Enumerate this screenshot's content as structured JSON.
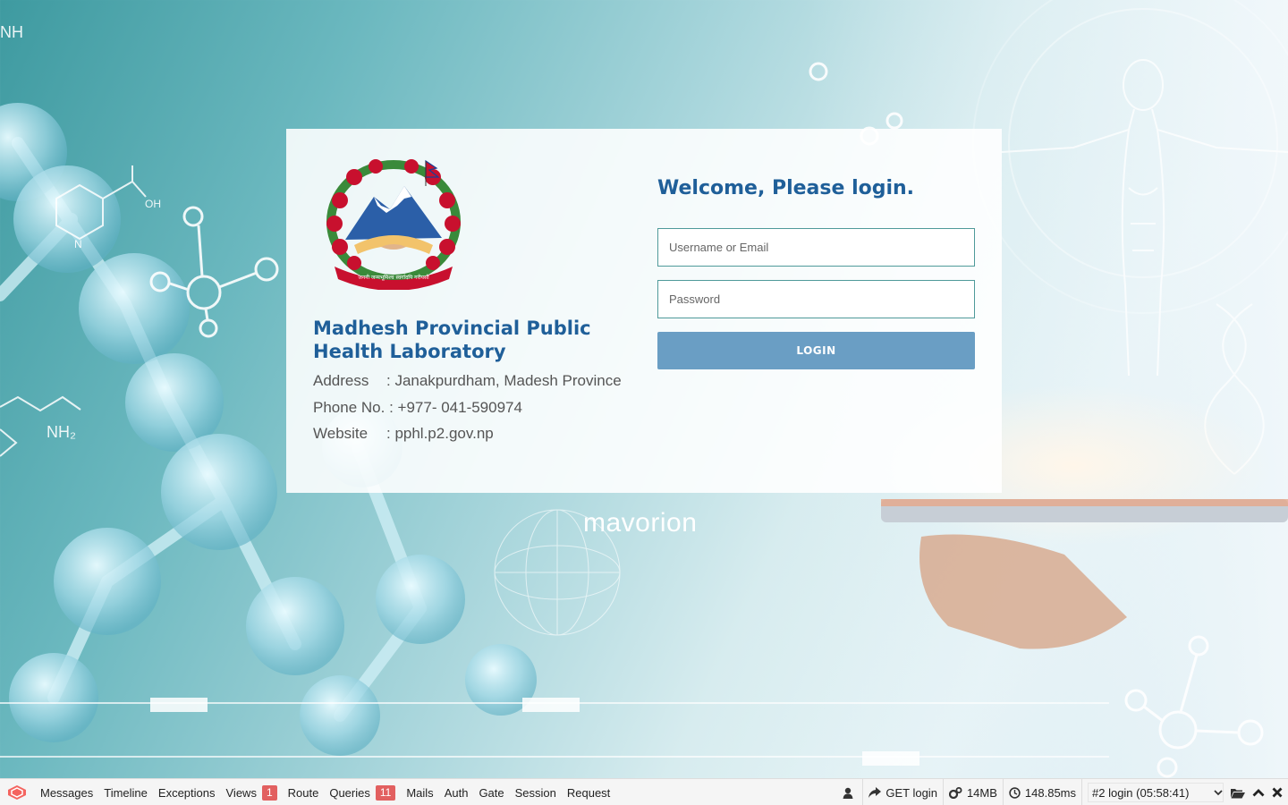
{
  "organization": {
    "name": "Madhesh Provincial Public Health Laboratory",
    "address_label": "Address",
    "address_value": ": Janakpurdham, Madesh Province",
    "phone_label": "Phone No.",
    "phone_value": ": +977- 041-590974",
    "website_label": "Website",
    "website_value": ": pphl.p2.gov.np",
    "emblem_motto": "जननी जन्मभूमिश्च स्वर्गादपि गरीयसी"
  },
  "login": {
    "heading": "Welcome, Please login.",
    "username_placeholder": "Username or Email",
    "password_placeholder": "Password",
    "button_label": "LOGIN"
  },
  "branding": {
    "text": "mavorion"
  },
  "debugbar": {
    "tabs": [
      {
        "label": "Messages"
      },
      {
        "label": "Timeline"
      },
      {
        "label": "Exceptions"
      },
      {
        "label": "Views",
        "badge": "1"
      },
      {
        "label": "Route"
      },
      {
        "label": "Queries",
        "badge": "11"
      },
      {
        "label": "Mails"
      },
      {
        "label": "Auth"
      },
      {
        "label": "Gate"
      },
      {
        "label": "Session"
      },
      {
        "label": "Request"
      }
    ],
    "request": "GET login",
    "memory": "14MB",
    "time": "148.85ms",
    "dataset_selected": "#2 login (05:58:41)",
    "icons": [
      "user-icon",
      "share-icon",
      "cogs-icon",
      "clock-icon",
      "folder-open-icon",
      "chevron-up-icon",
      "close-icon"
    ]
  },
  "colors": {
    "primary": "#1f5f99",
    "button": "#6a9ec4",
    "input_border": "#4f9a9a",
    "badge": "#e26060"
  }
}
